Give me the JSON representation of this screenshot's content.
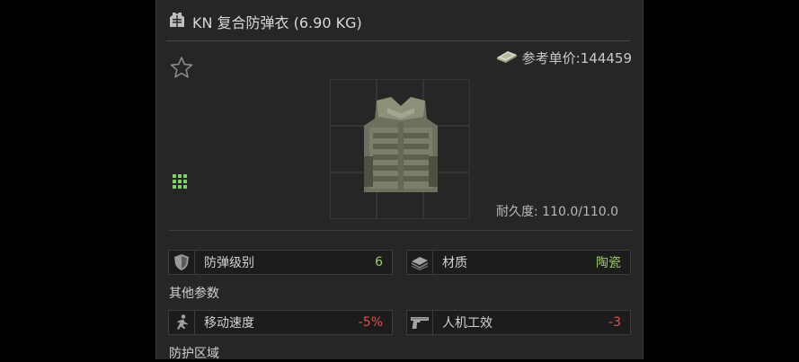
{
  "item": {
    "title": "KN 复合防弹衣 (6.90 KG)",
    "price_label": "参考单价:144459",
    "durability": "耐久度: 110.0/110.0"
  },
  "stats": [
    {
      "label": "防弹级别",
      "value": "6",
      "icon": "shield-icon"
    },
    {
      "label": "材质",
      "value": "陶瓷",
      "icon": "material-plates-icon"
    }
  ],
  "other_params_title": "其他参数",
  "other_params": [
    {
      "label": "移动速度",
      "value": "-5%",
      "icon": "running-man-icon"
    },
    {
      "label": "人机工效",
      "value": "-3",
      "icon": "pistol-icon"
    }
  ],
  "protection_title": "防护区域",
  "colors": {
    "positive": "#9cc96a",
    "negative": "#e05050",
    "panel": "#262626"
  }
}
